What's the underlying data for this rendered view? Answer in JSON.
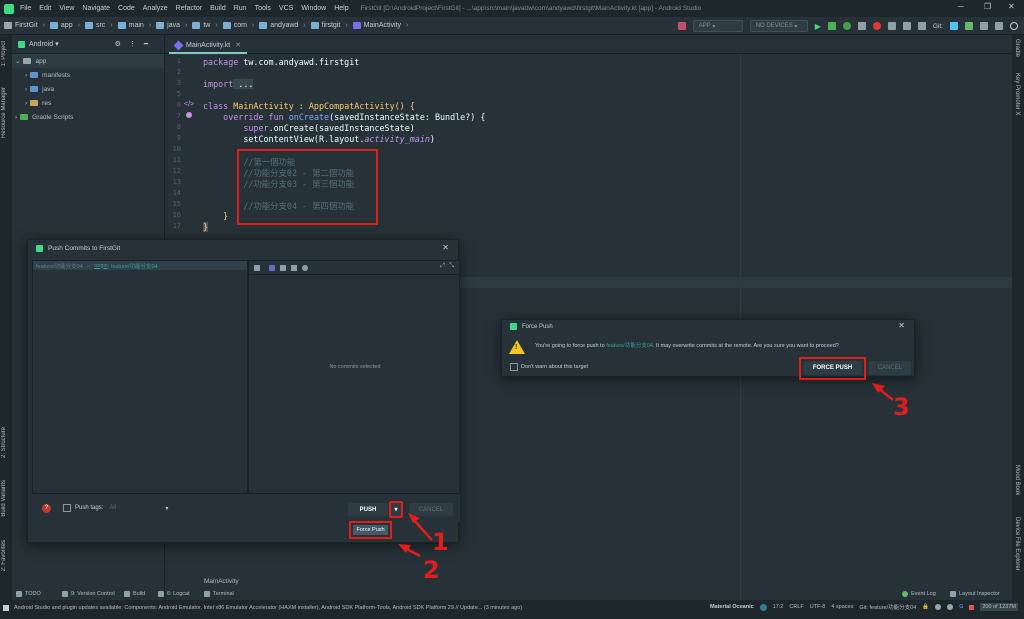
{
  "menubar": {
    "items": [
      "File",
      "Edit",
      "View",
      "Navigate",
      "Code",
      "Analyze",
      "Refactor",
      "Build",
      "Run",
      "Tools",
      "VCS",
      "Window",
      "Help"
    ],
    "window_title": "FirstGit [D:\\AndroidProject\\FirstGit] - ...\\app\\src\\main\\java\\tw\\com\\andyawd\\firstgit\\MainActivity.kt [app] - Android Studio"
  },
  "navbar": {
    "crumbs": [
      "FirstGit",
      "app",
      "src",
      "main",
      "java",
      "tw",
      "com",
      "andyawd",
      "firstgit",
      "MainActivity"
    ],
    "run_config": "APP",
    "devices": "NO DEVICES",
    "git_label": "Git:"
  },
  "left_tabs": [
    "1: Project",
    "Resource Manager",
    "2: Structure",
    "Build Variants",
    "2: Favorites"
  ],
  "right_tabs": [
    "Gradle",
    "Key Promoter X",
    "Mood Book",
    "Device File Explorer"
  ],
  "project": {
    "view": "Android",
    "tree": [
      {
        "label": "app",
        "level": 0
      },
      {
        "label": "manifests",
        "level": 1
      },
      {
        "label": "java",
        "level": 1
      },
      {
        "label": "res",
        "level": 1
      },
      {
        "label": "Gradle Scripts",
        "level": 0
      }
    ]
  },
  "editor": {
    "tab": "MainActivity.kt",
    "line_numbers": [
      "1",
      "2",
      "3",
      "5",
      "6",
      "7",
      "8",
      "9",
      "10",
      "11",
      "12",
      "13",
      "14",
      "15",
      "16",
      "17"
    ],
    "lines": {
      "l1_kw": "package",
      "l1_rest": " tw.com.andyawd.firstgit",
      "l3_kw": "import",
      "l3_rest": " ...",
      "l6_kw": "class",
      "l6_rest": " MainActivity : AppCompatActivity() {",
      "l7_kw": "override fun",
      "l7_fn": " onCreate",
      "l7_rest": "(savedInstanceState: Bundle?) {",
      "l8_kw": "super",
      "l8_rest": ".onCreate(savedInstanceState)",
      "l9_a": "setContentView(R.layout.",
      "l9_it": "activity_main",
      "l9_b": ")",
      "l11": "//第一個功能",
      "l12": "//功能分支02 - 第二個功能",
      "l13": "//功能分支03 - 第三個功能",
      "l15": "//功能分支04 - 第四個功能",
      "l16": "}",
      "l17": "}"
    },
    "footer_label": "MainActivity"
  },
  "push_dialog": {
    "title": "Push Commits to FirstGit",
    "branch_local": "feature/功能分支04",
    "branch_arrow": "→",
    "branch_remote_origin": "origin",
    "branch_remote": ": feature/功能分支04",
    "no_commits": "No commits selected",
    "push_tags_label": "Push tags:",
    "push_tags_value": "All",
    "push_button": "PUSH",
    "cancel_button": "CANCEL",
    "dropdown_item": "Force Push"
  },
  "force_dialog": {
    "title": "Force Push",
    "message_a": "You're going to force push to ",
    "message_branch": "feature/功能分支04",
    "message_b": ". It may overwrite commits at the remote. Are you sure you want to proceed?",
    "dont_warn": "Don't warn about this target",
    "force_button": "FORCE PUSH",
    "cancel_button": "CANCEL"
  },
  "annotations": [
    "1",
    "2",
    "3"
  ],
  "toolwindows": [
    "TODO",
    "9: Version Control",
    "Build",
    "6: Logcat",
    "Terminal"
  ],
  "event_log": "Event Log",
  "layout_inspector": "Layout Inspector",
  "status": {
    "message": "Android Studio and plugin updates available: Components: Android Emulator, Intel x86 Emulator Accelerator (HAXM installer), Android SDK Platform-Tools, Android SDK Platform 29 // Update... (3 minutes ago)",
    "theme": "Material Oceanic",
    "position": "17:2",
    "line_sep": "CRLF",
    "encoding": "UTF-8",
    "indent": "4 spaces",
    "git_branch": "Git: feature/功能分支04",
    "memory": "200 of 1237M"
  },
  "colors": {
    "accent": "#80cbc4",
    "annotation": "#e11d1d",
    "background": "#263238"
  }
}
